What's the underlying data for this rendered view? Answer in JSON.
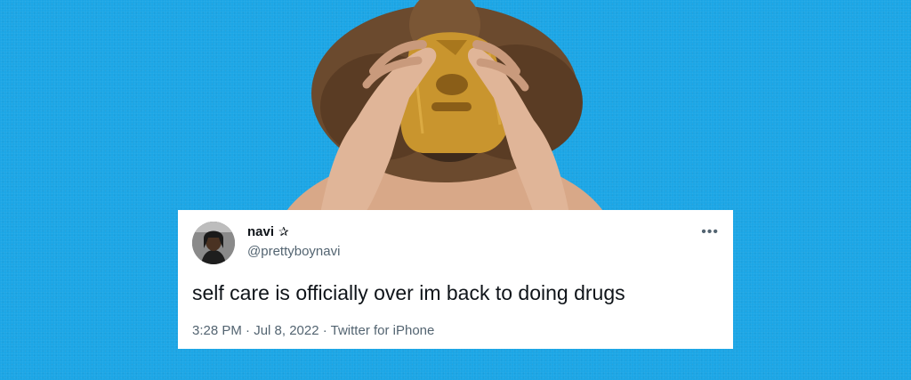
{
  "tweet": {
    "display_name": "navi",
    "name_emoji": "✰",
    "handle": "@prettyboynavi",
    "text": "self care is officially over im back to doing drugs",
    "timestamp": "3:28 PM · Jul 8, 2022 · Twitter for iPhone",
    "more_icon": "•••"
  },
  "colors": {
    "background": "#1ca6e6",
    "mask_gold": "#c9952e",
    "text_primary": "#0f1419",
    "text_secondary": "#536471"
  }
}
